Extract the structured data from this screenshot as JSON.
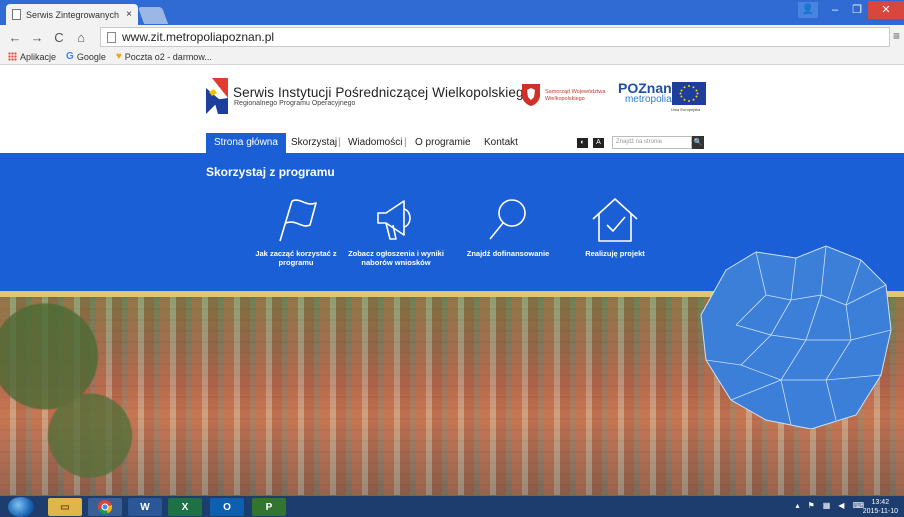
{
  "browser": {
    "tab_title": "Serwis Zintegrowanych In",
    "tab_close": "×",
    "url": "www.zit.metropoliapoznan.pl",
    "bookmarks": [
      "Aplikacje",
      "Google",
      "Poczta o2 - darmow..."
    ]
  },
  "header": {
    "title": "Serwis Instytucji Pośredniczącej Wielkopolskiego",
    "subtitle": "Regionalnego Programu Operacyjnego",
    "region_line1": "Samorząd Województwa",
    "region_line2": "Wielkopolskiego",
    "poznan_line1": "POZnan",
    "poznan_line2": "metropolia",
    "eu_label": "Unia Europejska"
  },
  "nav": {
    "items": [
      "Strona główna",
      "Skorzystaj",
      "Wiadomości",
      "O programie",
      "Kontakt"
    ],
    "separator": "|",
    "contrast_btn": "◐",
    "font_btn": "A",
    "search_placeholder": "Znajdź na stronie",
    "search_btn": "🔍"
  },
  "program": {
    "title": "Skorzystaj z programu",
    "features": [
      {
        "label": "Jak zacząć korzystać z programu",
        "icon": "flag-icon"
      },
      {
        "label": "Zobacz ogłoszenia i wyniki naborów wniosków",
        "icon": "megaphone-icon"
      },
      {
        "label": "Znajdź dofinansowanie",
        "icon": "magnifier-icon"
      },
      {
        "label": "Realizuję projekt",
        "icon": "house-check-icon"
      }
    ]
  },
  "taskbar": {
    "clock_time": "13:42",
    "clock_date": "2015-11-10",
    "apps": [
      "explorer",
      "chrome",
      "word",
      "excel",
      "outlook",
      "project"
    ]
  },
  "colors": {
    "brand_blue": "#1b5fd6",
    "gold_band": "#e2c76a",
    "map_blue": "#3b7fd9"
  }
}
